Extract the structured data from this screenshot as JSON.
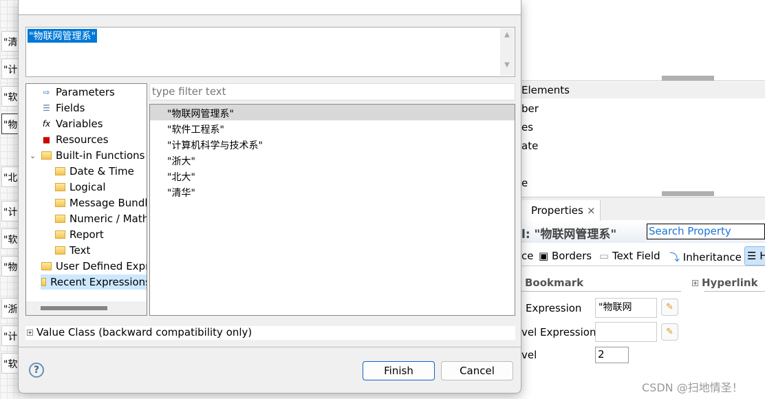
{
  "background_cells": [
    "\"清华\"",
    "\"计算\"",
    "\"软件\"",
    "\"物联\"",
    "\"北大\"",
    "\"计算\"",
    "\"软件\"",
    "\"物联\"",
    "\"浙大\"",
    "\"计算\"",
    "\"软件\""
  ],
  "right_panel": {
    "outline_header": "Elements",
    "outline_items": [
      "ber",
      "es",
      "ate",
      "e"
    ],
    "properties_tab": "Properties",
    "properties_title": "l: \"物联网管理系\"",
    "search_placeholder": "Search Property",
    "tabs": [
      "ce",
      "Borders",
      "Text Field",
      "Inheritance",
      "H"
    ],
    "bookmark_section": "Bookmark",
    "hyperlink_section": "Hyperlink",
    "rows": [
      {
        "label": "Expression",
        "value": "\"物联网"
      },
      {
        "label": "vel Expression",
        "value": ""
      },
      {
        "label": "vel",
        "value": "2"
      }
    ]
  },
  "dialog": {
    "expression_value": "\"物联网管理系\"",
    "tree": [
      {
        "label": "Parameters",
        "icon": "parameters-icon"
      },
      {
        "label": "Fields",
        "icon": "database-icon"
      },
      {
        "label": "Variables",
        "icon": "fx-icon"
      },
      {
        "label": "Resources",
        "icon": "resources-icon"
      },
      {
        "label": "Built-in Functions",
        "icon": "folder-icon",
        "expanded": true
      },
      {
        "label": "Date & Time",
        "icon": "folder-icon"
      },
      {
        "label": "Logical",
        "icon": "folder-icon"
      },
      {
        "label": "Message Bundle",
        "icon": "folder-icon"
      },
      {
        "label": "Numeric / Math",
        "icon": "folder-icon"
      },
      {
        "label": "Report",
        "icon": "folder-icon"
      },
      {
        "label": "Text",
        "icon": "folder-icon"
      },
      {
        "label": "User Defined Expressions",
        "icon": "folder-icon"
      },
      {
        "label": "Recent Expressions",
        "icon": "folder-icon",
        "selected": true
      }
    ],
    "filter_placeholder": "type filter text",
    "items": [
      "\"物联网管理系\"",
      "\"软件工程系\"",
      "\"计算机科学与技术系\"",
      "\"浙大\"",
      "\"北大\"",
      "\"清华\""
    ],
    "value_class": "Value Class (backward compatibility only)",
    "finish": "Finish",
    "cancel": "Cancel",
    "help": "?"
  },
  "watermark": "CSDN @扫地情圣！"
}
